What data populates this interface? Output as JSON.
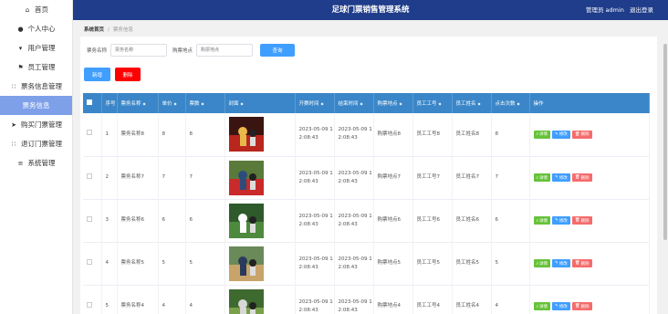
{
  "app": {
    "title": "足球门票销售管理系统",
    "user_label": "管理员 admin",
    "logout": "退出登录"
  },
  "sidebar": {
    "items": [
      {
        "icon": "⌂",
        "label": "首页"
      },
      {
        "icon": "👤",
        "label": "个人中心"
      },
      {
        "icon": "▾",
        "label": "用户管理"
      },
      {
        "icon": "⚑",
        "label": "员工管理"
      },
      {
        "icon": "∷",
        "label": "票务信息管理"
      },
      {
        "icon": "",
        "label": "票务信息"
      },
      {
        "icon": "➤",
        "label": "购买门票管理"
      },
      {
        "icon": "∷",
        "label": "退订门票管理"
      },
      {
        "icon": "≡",
        "label": "系统管理"
      }
    ]
  },
  "breadcrumb": {
    "home": "系统首页",
    "current": "票务信息"
  },
  "search": {
    "name_label": "票务名称",
    "name_placeholder": "票务名称",
    "place_label": "购票地点",
    "place_placeholder": "购票地点",
    "button": "查询"
  },
  "actions": {
    "add": "新增",
    "delete": "删除"
  },
  "table": {
    "headers": [
      "序号",
      "票务名称",
      "单价",
      "票数",
      "封面",
      "开赛时间",
      "结束时间",
      "购票地点",
      "员工工号",
      "员工姓名",
      "点击次数",
      "操作"
    ],
    "ops": {
      "detail": "详情",
      "edit": "修改",
      "remove": "删除"
    },
    "rows": [
      {
        "idx": "1",
        "name": "票务名称8",
        "price": "8",
        "count": "8",
        "start": "2023-05-09 12:08:43",
        "end": "2023-05-09 12:08:43",
        "place": "购票地点8",
        "staff_no": "员工工号8",
        "staff_name": "员工姓名8",
        "clicks": "8"
      },
      {
        "idx": "2",
        "name": "票务名称7",
        "price": "7",
        "count": "7",
        "start": "2023-05-09 12:08:43",
        "end": "2023-05-09 12:08:43",
        "place": "购票地点7",
        "staff_no": "员工工号7",
        "staff_name": "员工姓名7",
        "clicks": "7"
      },
      {
        "idx": "3",
        "name": "票务名称6",
        "price": "6",
        "count": "6",
        "start": "2023-05-09 12:08:43",
        "end": "2023-05-09 12:08:43",
        "place": "购票地点6",
        "staff_no": "员工工号6",
        "staff_name": "员工姓名6",
        "clicks": "6"
      },
      {
        "idx": "4",
        "name": "票务名称5",
        "price": "5",
        "count": "5",
        "start": "2023-05-09 12:08:43",
        "end": "2023-05-09 12:08:43",
        "place": "购票地点5",
        "staff_no": "员工工号5",
        "staff_name": "员工姓名5",
        "clicks": "5"
      },
      {
        "idx": "5",
        "name": "票务名称4",
        "price": "4",
        "count": "4",
        "start": "2023-05-09 12:08:43",
        "end": "2023-05-09 12:08:43",
        "place": "购票地点4",
        "staff_no": "员工工号4",
        "staff_name": "员工姓名4",
        "clicks": "4"
      }
    ]
  },
  "colors": {
    "topbar": "#1f3d8a",
    "sidebar_active": "#7ea0e8",
    "table_header": "#3a86c8",
    "primary": "#409eff",
    "danger": "#f56c6c",
    "success": "#67c23a"
  }
}
